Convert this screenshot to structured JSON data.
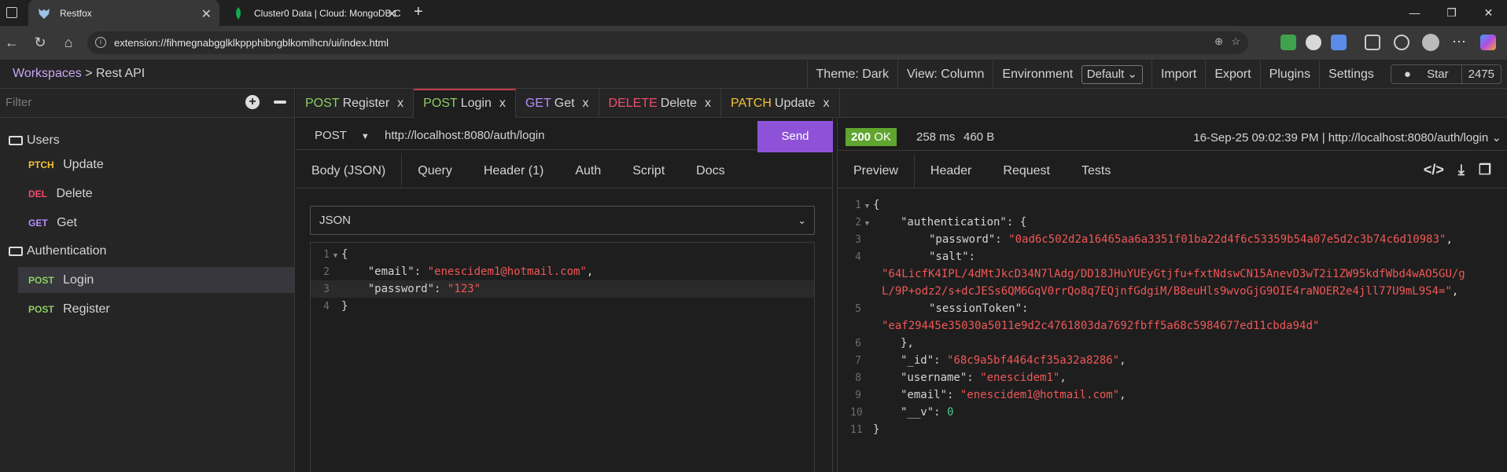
{
  "browser": {
    "tabs": [
      {
        "title": "Restfox",
        "active": true
      },
      {
        "title": "Cluster0 Data | Cloud: MongoDB C",
        "active": false
      }
    ],
    "url": "extension://fihmegnabgglklkppphibngblkomlhcn/ui/index.html"
  },
  "header": {
    "workspaces": "Workspaces",
    "separator": ">",
    "workspace_name": "Rest API",
    "theme": "Theme: Dark",
    "view": "View: Column",
    "environment_label": "Environment",
    "environment_value": "Default",
    "import": "Import",
    "export": "Export",
    "plugins": "Plugins",
    "settings": "Settings",
    "star": "Star",
    "star_count": "2475"
  },
  "sidebar": {
    "filter_placeholder": "Filter",
    "items": [
      {
        "type": "folder",
        "label": "Users"
      },
      {
        "type": "request",
        "method": "PTCH",
        "label": "Update"
      },
      {
        "type": "request",
        "method": "DEL",
        "label": "Delete"
      },
      {
        "type": "request",
        "method": "GET",
        "label": "Get"
      },
      {
        "type": "folder",
        "label": "Authentication"
      },
      {
        "type": "request",
        "method": "POST",
        "label": "Login",
        "active": true
      },
      {
        "type": "request",
        "method": "POST",
        "label": "Register"
      }
    ]
  },
  "request_tabs": [
    {
      "method": "POST",
      "name": "Register"
    },
    {
      "method": "POST",
      "name": "Login",
      "active": true
    },
    {
      "method": "GET",
      "name": "Get"
    },
    {
      "method": "DELETE",
      "name": "Delete"
    },
    {
      "method": "PATCH",
      "name": "Update"
    }
  ],
  "request": {
    "method": "POST",
    "url": "http://localhost:8080/auth/login",
    "send": "Send",
    "tabs": [
      "Body (JSON)",
      "Query",
      "Header (1)",
      "Auth",
      "Script",
      "Docs"
    ],
    "body_type": "JSON",
    "body_lines": {
      "l1": "{",
      "l2_key": "\"email\"",
      "l2_val": "\"enescidem1@hotmail.com\"",
      "l3_key": "\"password\"",
      "l3_val": "\"123\"",
      "l4": "}"
    }
  },
  "response": {
    "status_code": "200",
    "status_text": "OK",
    "time": "258 ms",
    "size": "460 B",
    "history": "16-Sep-25 09:02:39 PM | http://localhost:8080/auth/login",
    "tabs": [
      "Preview",
      "Header",
      "Request",
      "Tests"
    ],
    "body": {
      "authentication_key": "\"authentication\"",
      "password_key": "\"password\"",
      "password_val": "\"0ad6c502d2a16465aa6a3351f01ba22d4f6c53359b54a07e5d2c3b74c6d10983\"",
      "salt_key": "\"salt\"",
      "salt_val_1": "\"64LicfK4IPL/4dMtJkcD34N7lAdg/DD18JHuYUEyGtjfu+fxtNdswCN15AnevD3wT2i1ZW95kdfWbd4wAO5GU/g",
      "salt_val_2": "L/9P+odz2/s+dcJESs6QM6GqV0rrQo8q7EQjnfGdgiM/B8euHls9wvoGjG9OIE4raNOER2e4jll77U9mL9S4=\"",
      "session_key": "\"sessionToken\"",
      "session_val": "\"eaf29445e35030a5011e9d2c4761803da7692fbff5a68c5984677ed11cbda94d\"",
      "id_key": "\"_id\"",
      "id_val": "\"68c9a5bf4464cf35a32a8286\"",
      "username_key": "\"username\"",
      "username_val": "\"enescidem1\"",
      "email_key": "\"email\"",
      "email_val": "\"enescidem1@hotmail.com\"",
      "v_key": "\"__v\"",
      "v_val": "0"
    }
  },
  "colors": {
    "post": "#8cce5f",
    "get": "#b88ef8",
    "delete": "#f14c6a",
    "patch": "#f2c237",
    "send": "#8e52d9",
    "ok": "#60a52f",
    "string": "#f05757",
    "number": "#4ec994"
  }
}
